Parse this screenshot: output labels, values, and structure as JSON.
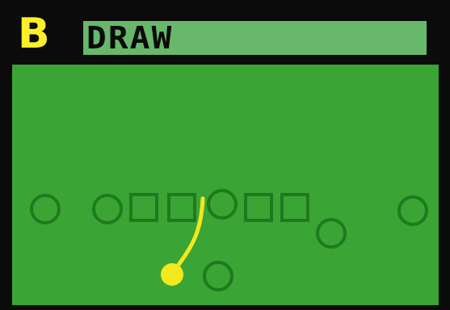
{
  "play": {
    "slot": "B",
    "name": "DRAW"
  },
  "colors": {
    "frame": "#0b0b0b",
    "field": "#3aa435",
    "marker_stroke": "#1f7a1f",
    "title_bar": "#67b86a",
    "slot_letter": "#ffef2a",
    "ball_carrier": "#f2e81d",
    "route": "#f2e81d"
  },
  "diagram": {
    "players": [
      {
        "role": "receiver",
        "shape": "circle"
      },
      {
        "role": "lineman",
        "shape": "circle"
      },
      {
        "role": "lineman",
        "shape": "square"
      },
      {
        "role": "lineman",
        "shape": "square"
      },
      {
        "role": "center",
        "shape": "circle"
      },
      {
        "role": "lineman",
        "shape": "square"
      },
      {
        "role": "lineman",
        "shape": "square"
      },
      {
        "role": "tight-end",
        "shape": "circle"
      },
      {
        "role": "receiver",
        "shape": "circle"
      },
      {
        "role": "back",
        "shape": "circle"
      },
      {
        "role": "ball-carrier",
        "shape": "circle",
        "highlighted": true
      }
    ],
    "route": {
      "from": "ball-carrier",
      "to": "center",
      "style": "curve"
    }
  }
}
